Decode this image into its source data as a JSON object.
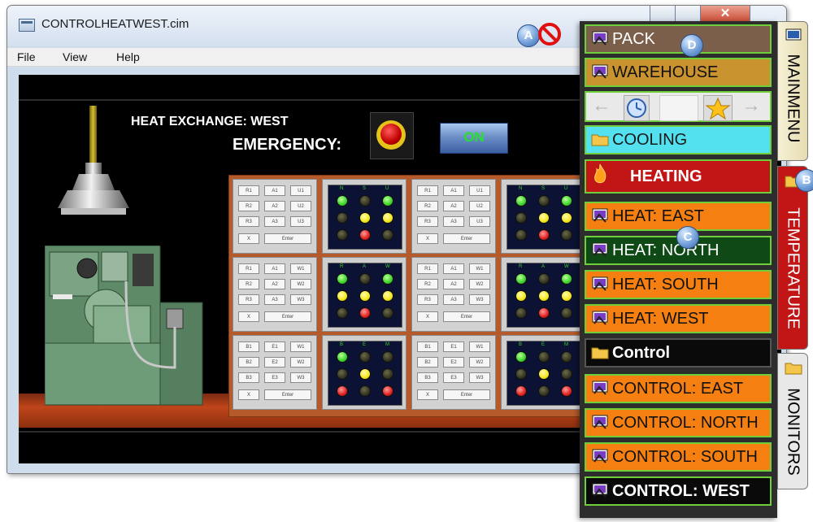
{
  "window": {
    "title": "CONTROLHEATWEST.cim"
  },
  "menubar": {
    "items": [
      "File",
      "View",
      "Help"
    ]
  },
  "hmi": {
    "label_heat_exchange": "HEAT EXCHANGE: WEST",
    "label_emergency": "EMERGENCY:",
    "on_button": "ON"
  },
  "keypads": [
    {
      "rows": [
        [
          "R1",
          "A1",
          "U1"
        ],
        [
          "R2",
          "A2",
          "U2"
        ],
        [
          "R3",
          "A3",
          "U3"
        ]
      ],
      "x": "X",
      "enter": "Enter"
    },
    {
      "rows": [
        [
          "R1",
          "A1",
          "W1"
        ],
        [
          "R2",
          "A2",
          "W2"
        ],
        [
          "R3",
          "A3",
          "W3"
        ]
      ],
      "x": "X",
      "enter": "Enter"
    },
    {
      "rows": [
        [
          "B1",
          "E1",
          "W1"
        ],
        [
          "B2",
          "E2",
          "W2"
        ],
        [
          "B3",
          "E3",
          "W3"
        ]
      ],
      "x": "X",
      "enter": "Enter"
    }
  ],
  "light_headers": [
    [
      "N",
      "S",
      "U"
    ],
    [
      "R",
      "A",
      "W"
    ],
    [
      "B",
      "E",
      "M"
    ]
  ],
  "sidemenu": {
    "items": [
      {
        "label": "PACK",
        "icon": "pack-icon"
      },
      {
        "label": "WAREHOUSE",
        "icon": "warehouse-icon"
      },
      {
        "label": "COOLING",
        "icon": "folder-icon"
      },
      {
        "label": "HEATING",
        "icon": "flame-icon"
      },
      {
        "label": "HEAT: EAST",
        "icon": "screen-icon"
      },
      {
        "label": "HEAT: NORTH",
        "icon": "screen-icon"
      },
      {
        "label": "HEAT: SOUTH",
        "icon": "screen-icon"
      },
      {
        "label": "HEAT: WEST",
        "icon": "screen-icon"
      },
      {
        "label": "Control",
        "icon": "folder-icon"
      },
      {
        "label": "CONTROL: EAST",
        "icon": "screen-icon"
      },
      {
        "label": "CONTROL: NORTH",
        "icon": "screen-icon"
      },
      {
        "label": "CONTROL: SOUTH",
        "icon": "screen-icon"
      },
      {
        "label": "CONTROL: WEST",
        "icon": "screen-icon"
      }
    ],
    "tabs": [
      "MAINMENU",
      "TEMPERATURE",
      "MONITORS"
    ]
  },
  "callouts": [
    "A",
    "B",
    "C",
    "D"
  ],
  "colors": {
    "menu_orange": "#f57f10",
    "menu_tan": "#c9932f",
    "menu_cyan": "#53e0ef",
    "menu_red": "#c21515",
    "menu_green": "#0f4a16",
    "menu_black": "#0a0a0a",
    "menu_border": "#6fcf3a"
  }
}
